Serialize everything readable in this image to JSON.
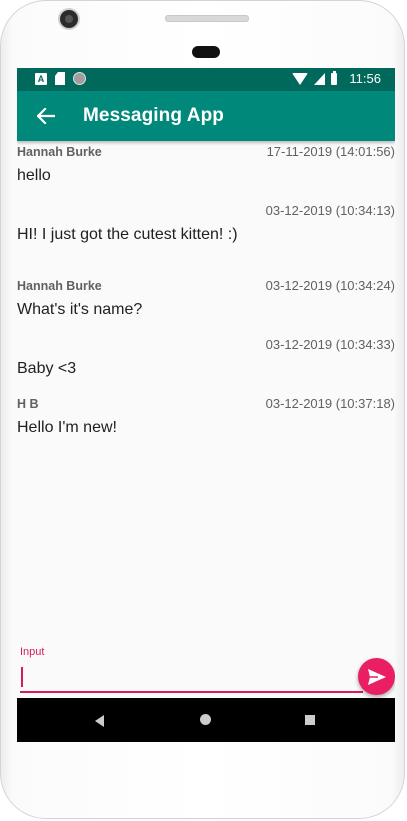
{
  "status_bar": {
    "time": "11:56",
    "icons": [
      "a-badge-icon",
      "sd-card-icon",
      "circle-icon",
      "wifi-icon",
      "signal-icon",
      "battery-icon"
    ]
  },
  "app_bar": {
    "title": "Messaging App",
    "back_icon": "arrow-back-icon"
  },
  "messages": [
    {
      "sender": "Hannah Burke",
      "timestamp": "17-11-2019 (14:01:56)",
      "text": "hello"
    },
    {
      "sender": "",
      "timestamp": "03-12-2019 (10:34:13)",
      "text": "HI! I just got the cutest kitten! :)"
    },
    {
      "sender": "Hannah Burke",
      "timestamp": "03-12-2019 (10:34:24)",
      "text": "What's it's name?"
    },
    {
      "sender": "",
      "timestamp": "03-12-2019 (10:34:33)",
      "text": "Baby <3"
    },
    {
      "sender": "H B",
      "timestamp": "03-12-2019 (10:37:18)",
      "text": "Hello I'm new!"
    }
  ],
  "composer": {
    "label": "Input",
    "value": "",
    "send_icon": "send-icon"
  },
  "nav_bar": {
    "icons": [
      "nav-back-icon",
      "nav-home-icon",
      "nav-recents-icon"
    ]
  },
  "colors": {
    "status_bar": "#00695c",
    "app_bar": "#00897b",
    "accent": "#e91e63",
    "background": "#fafafa"
  }
}
